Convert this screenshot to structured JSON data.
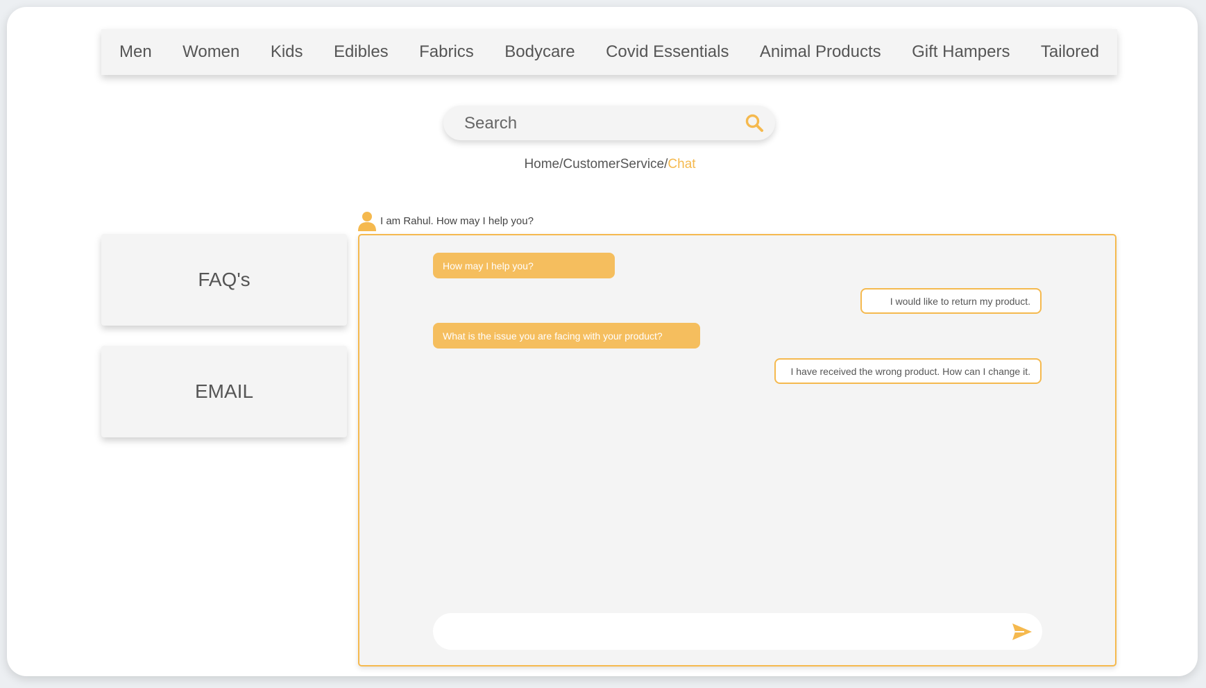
{
  "nav": {
    "items": [
      "Men",
      "Women",
      "Kids",
      "Edibles",
      "Fabrics",
      "Bodycare",
      "Covid Essentials",
      "Animal Products",
      "Gift Hampers",
      "Tailored"
    ]
  },
  "search": {
    "placeholder": "Search",
    "icon": "search-icon"
  },
  "breadcrumb": {
    "parts": [
      "Home",
      "CustomerService"
    ],
    "separator": "/",
    "active": "Chat"
  },
  "sidebar": {
    "faq_label": "FAQ's",
    "email_label": "EMAIL"
  },
  "chat": {
    "agent_greeting": "I am Rahul. How may I help you?",
    "agent_icon": "user-avatar-icon",
    "messages": [
      {
        "from": "agent",
        "text": "How may I help you?"
      },
      {
        "from": "user",
        "text": "I would like to return my product."
      },
      {
        "from": "agent",
        "text": "What is the issue you are facing with your product?"
      },
      {
        "from": "user",
        "text": "I have received the wrong product. How can I change it."
      }
    ],
    "compose_value": "",
    "send_icon": "send-icon"
  },
  "colors": {
    "accent": "#f5b94e",
    "panel": "#f4f4f4",
    "text": "#555555"
  }
}
